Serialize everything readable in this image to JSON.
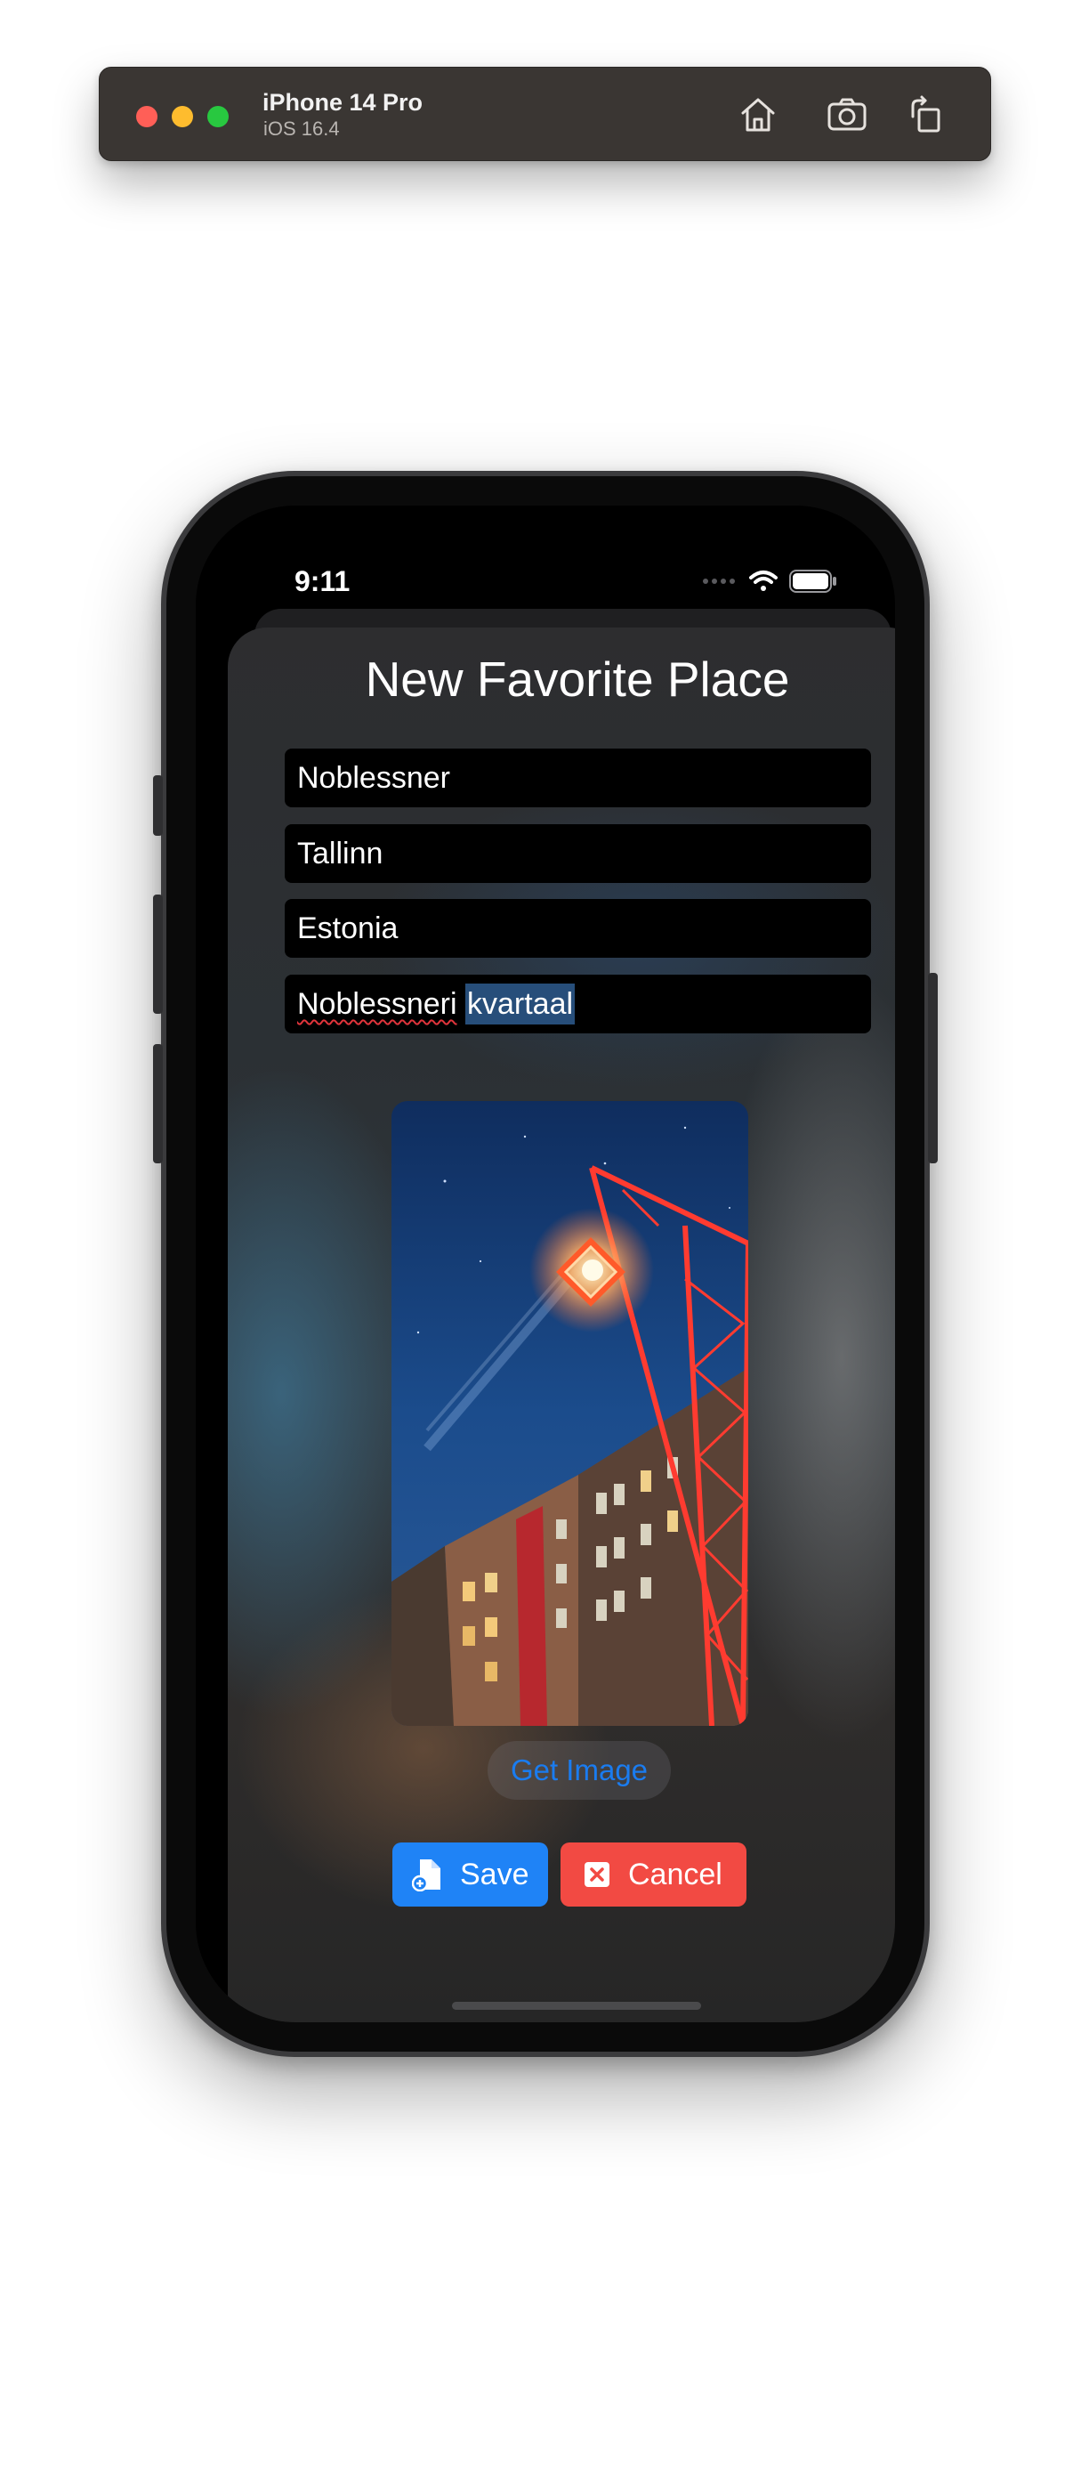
{
  "simulator": {
    "device_name": "iPhone 14 Pro",
    "os_version": "iOS 16.4",
    "buttons": [
      "home-icon",
      "screenshot-icon",
      "rotate-icon"
    ]
  },
  "status_bar": {
    "time": "9:11"
  },
  "sheet": {
    "title": "New Favorite Place",
    "fields": [
      {
        "value": "Noblessner"
      },
      {
        "value": "Tallinn"
      },
      {
        "value": "Estonia"
      },
      {
        "value_misspelled": "Noblessneri",
        "value_selected": "kvartaal"
      }
    ],
    "get_image_label": "Get Image",
    "save_label": "Save",
    "cancel_label": "Cancel"
  },
  "colors": {
    "accent_blue": "#1f83f6",
    "cancel_red": "#f24a43",
    "link_blue": "#1a7cf0"
  }
}
